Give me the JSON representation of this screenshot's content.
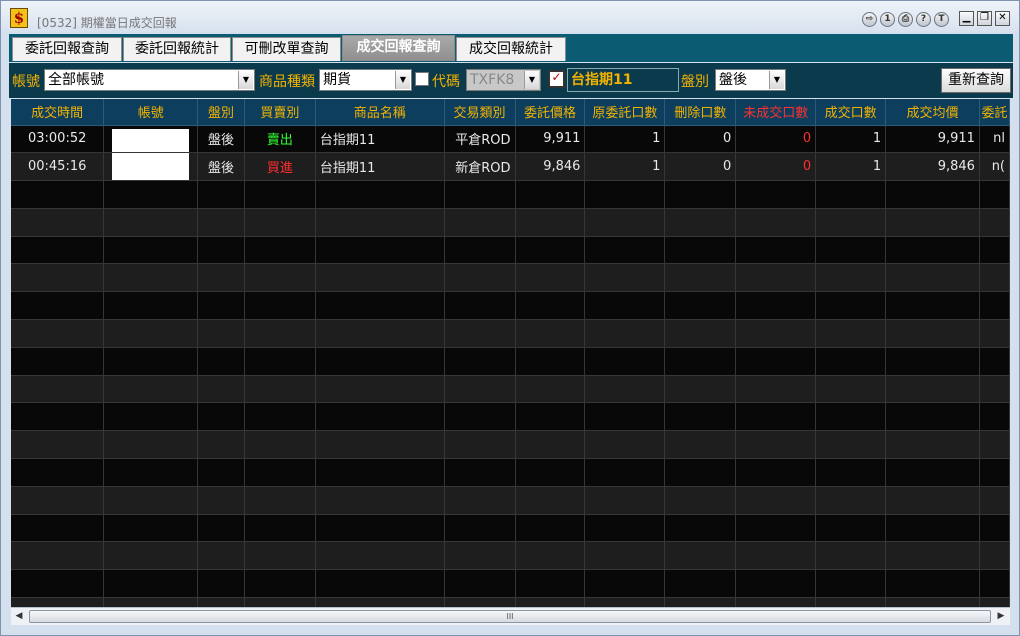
{
  "window": {
    "title": "[0532] 期權當日成交回報"
  },
  "titlebar_buttons": [
    "1",
    "?",
    "T"
  ],
  "tabs": [
    {
      "label": "委託回報查詢",
      "active": false
    },
    {
      "label": "委託回報統計",
      "active": false
    },
    {
      "label": "可刪改單查詢",
      "active": false
    },
    {
      "label": "成交回報查詢",
      "active": true
    },
    {
      "label": "成交回報統計",
      "active": false
    }
  ],
  "filters": {
    "account_label": "帳號",
    "account_value": "全部帳號",
    "product_type_label": "商品種類",
    "product_type_value": "期貨",
    "code_label": "代碼",
    "code_value": "TXFK8",
    "product_name": "台指期11",
    "session_label": "盤別",
    "session_value": "盤後",
    "requery_label": "重新查詢"
  },
  "columns": [
    "成交時間",
    "帳號",
    "盤別",
    "買賣別",
    "商品名稱",
    "交易類別",
    "委託價格",
    "原委託口數",
    "刪除口數",
    "未成交口數",
    "成交口數",
    "成交均價",
    "委託"
  ],
  "rows": [
    {
      "time": "03:00:52",
      "account": "",
      "session": "盤後",
      "side": "賣出",
      "product": "台指期11",
      "trade_type": "平倉ROD",
      "price": "9,911",
      "orig_qty": "1",
      "cancel_qty": "0",
      "unfilled_qty": "0",
      "filled_qty": "1",
      "avg_price": "9,911",
      "order_no": "nl"
    },
    {
      "time": "00:45:16",
      "account": "",
      "session": "盤後",
      "side": "買進",
      "product": "台指期11",
      "trade_type": "新倉ROD",
      "price": "9,846",
      "orig_qty": "1",
      "cancel_qty": "0",
      "unfilled_qty": "0",
      "filled_qty": "1",
      "avg_price": "9,846",
      "order_no": "n("
    }
  ],
  "colors": {
    "header_text": "#f2b200",
    "sell": "#33ff33",
    "buy": "#ff2e2e",
    "grid_bg": "#0a0a0a",
    "header_bg": "#0d3e5d"
  },
  "scrollbar": {
    "thumb_grip": "III"
  }
}
